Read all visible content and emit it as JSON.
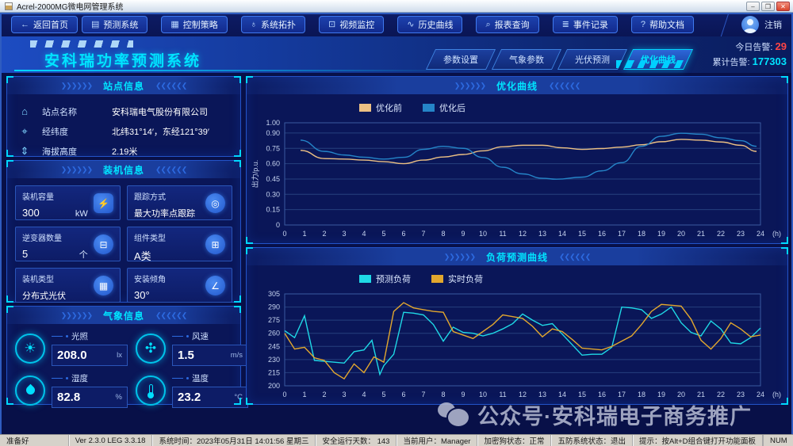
{
  "window": {
    "title": "Acrel-2000MG微电网管理系统",
    "controls": {
      "minimize": "–",
      "maximize": "❐",
      "close": "✕"
    }
  },
  "nav": {
    "back": {
      "glyph": "←",
      "label": "返回首页"
    },
    "items": [
      {
        "icon": "forecast-system-icon",
        "glyph": "▤",
        "label": "预测系统"
      },
      {
        "icon": "control-strategy-icon",
        "glyph": "▦",
        "label": "控制策略"
      },
      {
        "icon": "system-topology-icon",
        "glyph": "♁",
        "label": "系统拓扑"
      },
      {
        "icon": "video-monitor-icon",
        "glyph": "⊡",
        "label": "视频监控"
      },
      {
        "icon": "history-curve-icon",
        "glyph": "∿",
        "label": "历史曲线"
      },
      {
        "icon": "report-query-icon",
        "glyph": "⌕",
        "label": "报表查询"
      },
      {
        "icon": "event-record-icon",
        "glyph": "≣",
        "label": "事件记录"
      },
      {
        "icon": "help-doc-icon",
        "glyph": "?",
        "label": "帮助文档"
      }
    ],
    "logout": "注销"
  },
  "header": {
    "title": "安科瑞功率预测系统",
    "tabs": [
      {
        "label": "参数设置",
        "active": false
      },
      {
        "label": "气象参数",
        "active": false
      },
      {
        "label": "光伏预测",
        "active": false
      },
      {
        "label": "优化曲线",
        "active": true
      }
    ],
    "alarms": {
      "today_label": "今日告警:",
      "today_value": "29",
      "total_label": "累计告警:",
      "total_value": "177303"
    }
  },
  "station": {
    "title": "站点信息",
    "rows": [
      {
        "icon": "home-icon",
        "glyph": "⌂",
        "label": "站点名称",
        "value": "安科瑞电气股份有限公司"
      },
      {
        "icon": "location-icon",
        "glyph": "⌖",
        "label": "经纬度",
        "value": "北纬31°14′，东经121°39′"
      },
      {
        "icon": "altitude-icon",
        "glyph": "⇕",
        "label": "海拔高度",
        "value": "2.19米"
      }
    ]
  },
  "install": {
    "title": "装机信息",
    "cards": [
      {
        "icon": "capacity-icon",
        "glyph": "⚡",
        "label": "装机容量",
        "value": "300",
        "unit": "kW"
      },
      {
        "icon": "tracking-icon",
        "glyph": "◎",
        "label": "跟踪方式",
        "value": "最大功率点跟踪",
        "unit": ""
      },
      {
        "icon": "inverter-icon",
        "glyph": "⊟",
        "label": "逆变器数量",
        "value": "5",
        "unit": "个"
      },
      {
        "icon": "module-type-icon",
        "glyph": "⊞",
        "label": "组件类型",
        "value": "A类",
        "unit": ""
      },
      {
        "icon": "install-type-icon",
        "glyph": "▦",
        "label": "装机类型",
        "value": "分布式光伏",
        "unit": ""
      },
      {
        "icon": "tilt-angle-icon",
        "glyph": "∠",
        "label": "安装倾角",
        "value": "30°",
        "unit": ""
      }
    ]
  },
  "weather": {
    "title": "气象信息",
    "items": [
      {
        "icon": "sun-icon",
        "glyph": "☀",
        "label": "光照",
        "value": "208.0",
        "unit": "lx"
      },
      {
        "icon": "fan-icon",
        "glyph": "✣",
        "label": "风速",
        "value": "1.5",
        "unit": "m/s"
      },
      {
        "icon": "humidity-drop-icon",
        "glyph": "",
        "label": "湿度",
        "value": "82.8",
        "unit": "%"
      },
      {
        "icon": "thermometer-icon",
        "glyph": "",
        "label": "温度",
        "value": "23.2",
        "unit": "°C"
      }
    ]
  },
  "chart_data": [
    {
      "type": "line",
      "title": "优化曲线",
      "ylabel": "出力/p.u.",
      "x_unit": "(h)",
      "xlim": [
        0,
        24
      ],
      "ylim": [
        0,
        1.0
      ],
      "yticks": [
        "1.00",
        "0.90",
        "0.75",
        "0.60",
        "0.45",
        "0.30",
        "0.15",
        "0"
      ],
      "xticks": [
        0,
        1,
        2,
        3,
        4,
        5,
        6,
        7,
        8,
        9,
        10,
        11,
        12,
        13,
        14,
        15,
        16,
        17,
        18,
        19,
        20,
        21,
        22,
        23,
        24
      ],
      "grid": "horizontal",
      "legend_position": "top",
      "smooth": true,
      "series": [
        {
          "name": "优化前",
          "color": "#ecc084",
          "points": [
            [
              0.8,
              0.73
            ],
            [
              2,
              0.65
            ],
            [
              3,
              0.645
            ],
            [
              4,
              0.635
            ],
            [
              5,
              0.62
            ],
            [
              6,
              0.6
            ],
            [
              7,
              0.635
            ],
            [
              8,
              0.665
            ],
            [
              9,
              0.69
            ],
            [
              10,
              0.725
            ],
            [
              11,
              0.765
            ],
            [
              12,
              0.78
            ],
            [
              13,
              0.78
            ],
            [
              14,
              0.755
            ],
            [
              15,
              0.74
            ],
            [
              16,
              0.748
            ],
            [
              17,
              0.762
            ],
            [
              18,
              0.785
            ],
            [
              19,
              0.815
            ],
            [
              20,
              0.838
            ],
            [
              21,
              0.83
            ],
            [
              22,
              0.812
            ],
            [
              23,
              0.78
            ],
            [
              23.8,
              0.72
            ]
          ]
        },
        {
          "name": "优化后",
          "color": "#2585c8",
          "points": [
            [
              0.8,
              0.83
            ],
            [
              2,
              0.72
            ],
            [
              3,
              0.685
            ],
            [
              4,
              0.663
            ],
            [
              5,
              0.645
            ],
            [
              6,
              0.662
            ],
            [
              7,
              0.74
            ],
            [
              8,
              0.77
            ],
            [
              9,
              0.75
            ],
            [
              10,
              0.66
            ],
            [
              11,
              0.565
            ],
            [
              12,
              0.5
            ],
            [
              13,
              0.457
            ],
            [
              13.7,
              0.448
            ],
            [
              15,
              0.468
            ],
            [
              16,
              0.53
            ],
            [
              17,
              0.61
            ],
            [
              18,
              0.77
            ],
            [
              19,
              0.868
            ],
            [
              20,
              0.898
            ],
            [
              21,
              0.888
            ],
            [
              22,
              0.853
            ],
            [
              23,
              0.825
            ],
            [
              23.8,
              0.77
            ]
          ]
        }
      ]
    },
    {
      "type": "line",
      "title": "负荷预测曲线",
      "ylabel": "",
      "x_unit": "(h)",
      "xlim": [
        0,
        24
      ],
      "ylim": [
        200,
        305
      ],
      "yticks": [
        "305",
        "290",
        "275",
        "260",
        "245",
        "230",
        "215",
        "200"
      ],
      "xticks": [
        0,
        1,
        2,
        3,
        4,
        5,
        6,
        7,
        8,
        9,
        10,
        11,
        12,
        13,
        14,
        15,
        16,
        17,
        18,
        19,
        20,
        21,
        22,
        23,
        24
      ],
      "grid": "horizontal",
      "legend_position": "top",
      "smooth": false,
      "series": [
        {
          "name": "预测负荷",
          "color": "#1fd9e6",
          "points": [
            [
              0,
              263
            ],
            [
              0.5,
              255
            ],
            [
              1,
              280
            ],
            [
              1.5,
              229
            ],
            [
              2,
              228
            ],
            [
              2.5,
              227
            ],
            [
              3,
              226
            ],
            [
              3.5,
              239
            ],
            [
              4,
              241
            ],
            [
              4.4,
              252
            ],
            [
              4.8,
              213
            ],
            [
              5,
              223
            ],
            [
              5.5,
              236
            ],
            [
              6,
              284
            ],
            [
              6.5,
              283
            ],
            [
              7,
              281
            ],
            [
              7.5,
              270
            ],
            [
              8,
              251
            ],
            [
              8.5,
              267
            ],
            [
              9,
              261
            ],
            [
              9.5,
              260
            ],
            [
              10,
              257
            ],
            [
              10.5,
              260
            ],
            [
              11,
              265
            ],
            [
              11.5,
              271
            ],
            [
              12,
              282
            ],
            [
              12.5,
              275
            ],
            [
              13,
              269
            ],
            [
              13.5,
              271
            ],
            [
              14,
              259
            ],
            [
              14.5,
              247
            ],
            [
              15,
              235
            ],
            [
              15.5,
              236
            ],
            [
              16,
              236
            ],
            [
              16.5,
              244
            ],
            [
              17,
              290
            ],
            [
              17.5,
              289
            ],
            [
              18,
              287
            ],
            [
              18.5,
              277
            ],
            [
              19,
              282
            ],
            [
              19.5,
              290
            ],
            [
              20,
              272
            ],
            [
              20.5,
              261
            ],
            [
              21,
              257
            ],
            [
              21.5,
              274
            ],
            [
              22,
              265
            ],
            [
              22.5,
              249
            ],
            [
              23,
              248
            ],
            [
              23.5,
              255
            ],
            [
              24,
              266
            ]
          ]
        },
        {
          "name": "实时负荷",
          "color": "#e2a72e",
          "points": [
            [
              0,
              260
            ],
            [
              0.5,
              242
            ],
            [
              1,
              244
            ],
            [
              1.5,
              232
            ],
            [
              2,
              229
            ],
            [
              2.5,
              215
            ],
            [
              3,
              208
            ],
            [
              3.5,
              225
            ],
            [
              4,
              215
            ],
            [
              4.5,
              233
            ],
            [
              5,
              227
            ],
            [
              5.5,
              285
            ],
            [
              6,
              295
            ],
            [
              6.5,
              289
            ],
            [
              7,
              287
            ],
            [
              7.5,
              285
            ],
            [
              8,
              284
            ],
            [
              8.5,
              262
            ],
            [
              9,
              258
            ],
            [
              9.5,
              254
            ],
            [
              10,
              262
            ],
            [
              10.5,
              270
            ],
            [
              11,
              281
            ],
            [
              11.5,
              279
            ],
            [
              12,
              277
            ],
            [
              12.5,
              268
            ],
            [
              13,
              256
            ],
            [
              13.5,
              265
            ],
            [
              14,
              262
            ],
            [
              14.5,
              253
            ],
            [
              15,
              243
            ],
            [
              15.5,
              242
            ],
            [
              16,
              241
            ],
            [
              16.5,
              245
            ],
            [
              17,
              251
            ],
            [
              17.5,
              257
            ],
            [
              18,
              270
            ],
            [
              18.5,
              285
            ],
            [
              19,
              293
            ],
            [
              19.5,
              292
            ],
            [
              20,
              291
            ],
            [
              20.5,
              276
            ],
            [
              21,
              252
            ],
            [
              21.5,
              242
            ],
            [
              22,
              254
            ],
            [
              22.5,
              272
            ],
            [
              23,
              265
            ],
            [
              23.5,
              256
            ],
            [
              24,
              258
            ]
          ]
        }
      ]
    }
  ],
  "watermark": {
    "icon": "wechat-icon",
    "text": "公众号·安科瑞电子商务推广"
  },
  "statusbar": {
    "items": [
      "准备好",
      "Ver 2.3.0 LEG 3.3.18",
      "系统时间：2023年05月31日  14:01:56   星期三",
      "安全运行天数： 143",
      "当前用户：Manager",
      "加密狗状态：正常",
      "五防系统状态：退出",
      "提示：按Alt+D组合键打开功能面板",
      "NUM"
    ]
  },
  "colors": {
    "accent_cyan": "#00e4ff",
    "alarm_red": "#ff4545",
    "panel_border": "#2353c8"
  },
  "decoration": {
    "chevrons_right": "❯❯❯❯❯❯",
    "chevrons_left": "❮❮❮❮❮❮"
  }
}
